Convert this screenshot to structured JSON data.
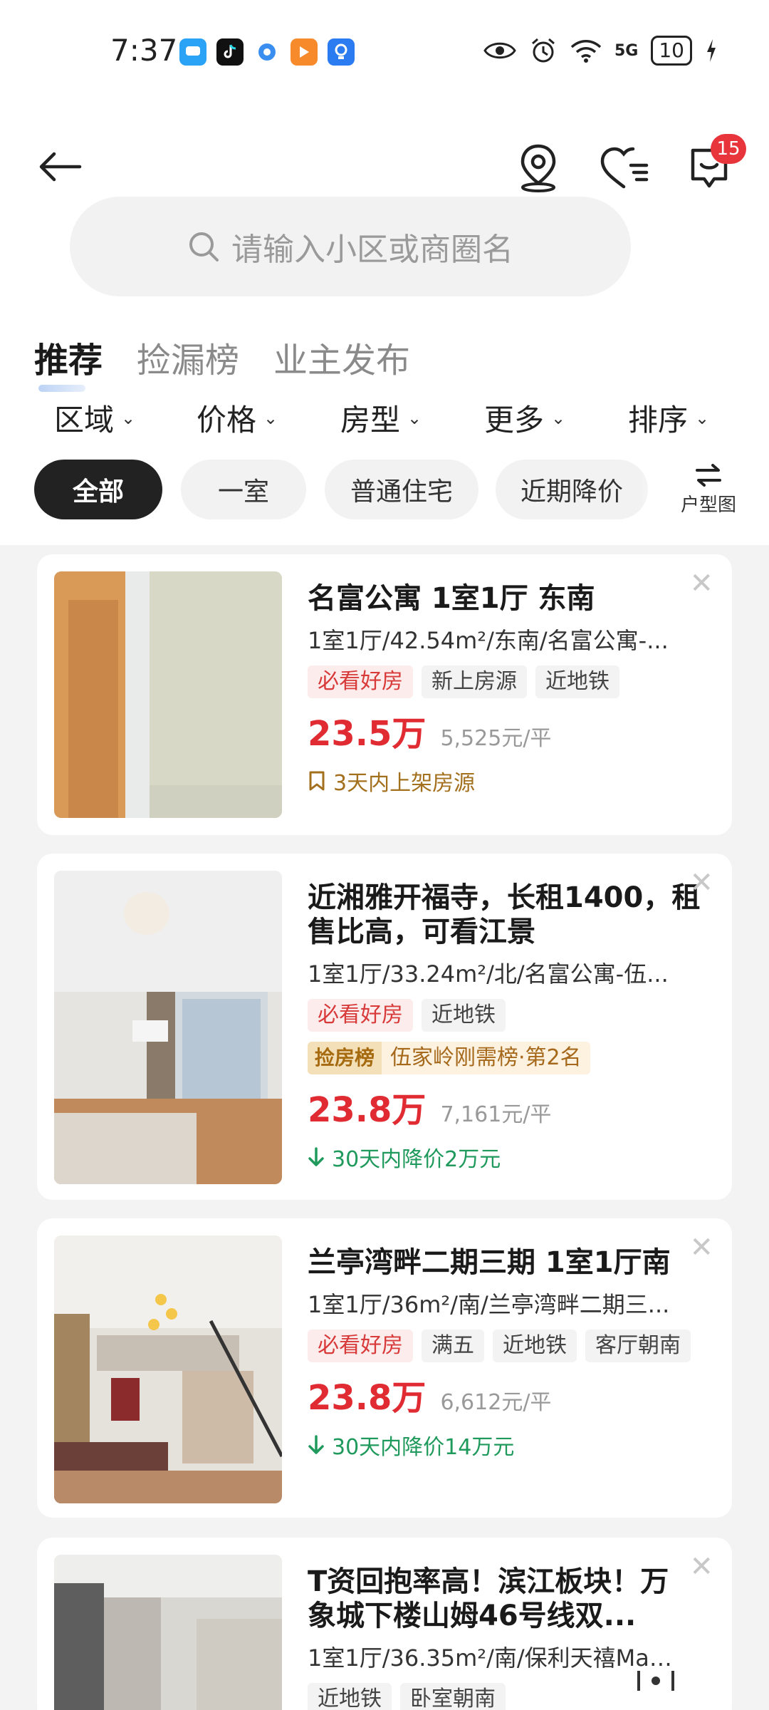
{
  "status_bar": {
    "time": "7:37",
    "battery": "10",
    "network": "5G",
    "notification_icons": [
      "message-icon",
      "tiktok-icon",
      "browser-icon",
      "video-icon",
      "bulb-icon"
    ]
  },
  "header": {
    "message_badge": "15"
  },
  "search": {
    "placeholder": "请输入小区或商圈名"
  },
  "tabs": [
    {
      "label": "推荐",
      "active": true
    },
    {
      "label": "捡漏榜",
      "active": false
    },
    {
      "label": "业主发布",
      "active": false
    }
  ],
  "filters": [
    {
      "label": "区域"
    },
    {
      "label": "价格"
    },
    {
      "label": "房型"
    },
    {
      "label": "更多"
    },
    {
      "label": "排序"
    }
  ],
  "chips": [
    {
      "label": "全部",
      "active": true
    },
    {
      "label": "一室",
      "active": false
    },
    {
      "label": "普通住宅",
      "active": false
    },
    {
      "label": "近期降价",
      "active": false
    }
  ],
  "floorplan": {
    "label": "户型图"
  },
  "listings": [
    {
      "title": "名富公寓 1室1厅 东南",
      "subtitle": "1室1厅/42.54m²/东南/名富公寓-...",
      "tags": [
        "必看好房",
        "新上房源",
        "近地铁"
      ],
      "price": "23.5万",
      "unit_price": "5,525元/平",
      "note": "3天内上架房源"
    },
    {
      "title": "近湘雅开福寺，长租1400，租售比高，可看江景",
      "subtitle": "1室1厅/33.24m²/北/名富公寓-伍...",
      "tags": [
        "必看好房",
        "近地铁"
      ],
      "rank_label": "捡房榜",
      "rank_text": "伍家岭刚需榜·第2名",
      "price": "23.8万",
      "unit_price": "7,161元/平",
      "note": "30天内降价2万元"
    },
    {
      "title": "兰亭湾畔二期三期 1室1厅南",
      "subtitle": "1室1厅/36m²/南/兰亭湾畔二期三...",
      "tags": [
        "必看好房",
        "满五",
        "近地铁",
        "客厅朝南"
      ],
      "price": "23.8万",
      "unit_price": "6,612元/平",
      "note": "30天内降价14万元"
    },
    {
      "title": "T资回抱率高！滨江板块！万象城下楼山姆46号线双...",
      "subtitle": "1室1厅/36.35m²/南/保利天禧Mall...",
      "tags": [
        "近地铁",
        "卧室朝南"
      ]
    }
  ]
}
